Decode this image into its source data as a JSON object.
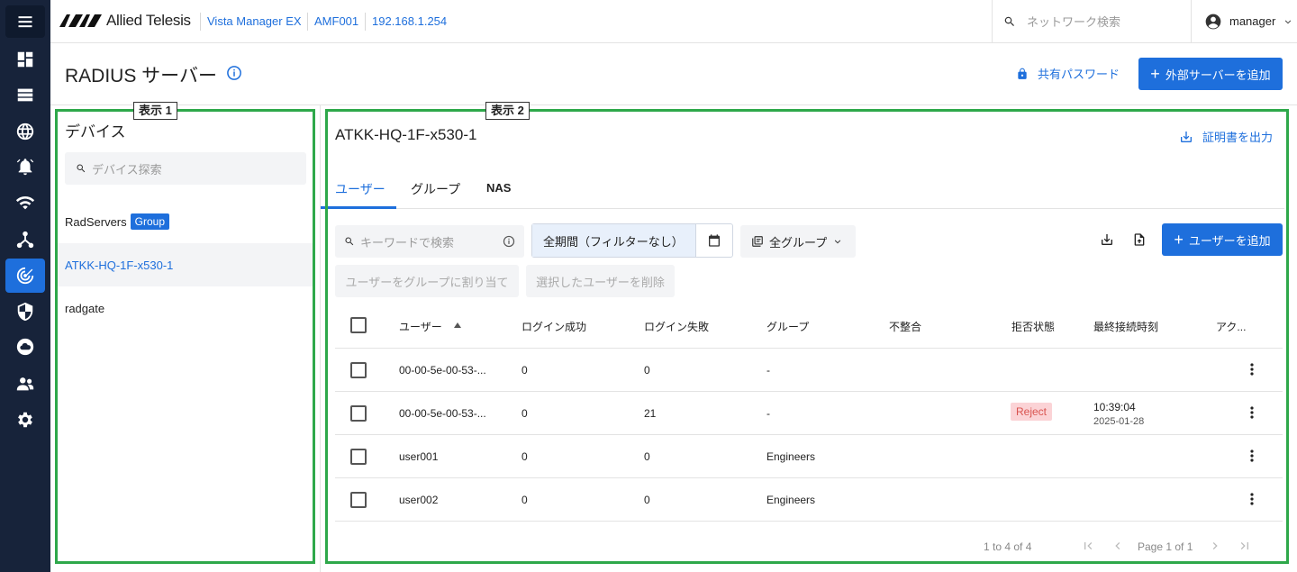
{
  "header": {
    "brand": "Allied Telesis",
    "breadcrumbs": [
      "Vista Manager EX",
      "AMF001",
      "192.168.1.254"
    ],
    "search_placeholder": "ネットワーク検索",
    "user": "manager"
  },
  "page": {
    "title": "RADIUS サーバー",
    "shared_password": "共有パスワード",
    "add_external_server": "外部サーバーを追加"
  },
  "annotations": {
    "view1": "表示 1",
    "view2": "表示 2"
  },
  "devices": {
    "title": "デバイス",
    "search_placeholder": "デバイス探索",
    "items": [
      {
        "name": "RadServers",
        "badge": "Group"
      },
      {
        "name": "ATKK-HQ-1F-x530-1",
        "selected": true
      },
      {
        "name": "radgate"
      }
    ]
  },
  "detail": {
    "title": "ATKK-HQ-1F-x530-1",
    "export_cert": "証明書を出力",
    "tabs": [
      "ユーザー",
      "グループ",
      "NAS"
    ],
    "active_tab": "ユーザー",
    "keyword_placeholder": "キーワードで検索",
    "period": "全期間（フィルターなし）",
    "group_filter": "全グループ",
    "add_user": "ユーザーを追加",
    "assign_group": "ユーザーをグループに割り当て",
    "delete_selected": "選択したユーザーを削除"
  },
  "table": {
    "columns": [
      "ユーザー",
      "ログイン成功",
      "ログイン失敗",
      "グループ",
      "不整合",
      "拒否状態",
      "最終接続時刻",
      "アク..."
    ],
    "rows": [
      {
        "user": "00-00-5e-00-53-...",
        "success": "0",
        "fail": "0",
        "group": "-",
        "mismatch": "",
        "reject": "",
        "time": "",
        "date": ""
      },
      {
        "user": "00-00-5e-00-53-...",
        "success": "0",
        "fail": "21",
        "group": "-",
        "mismatch": "",
        "reject": "Reject",
        "time": "10:39:04",
        "date": "2025-01-28"
      },
      {
        "user": "user001",
        "success": "0",
        "fail": "0",
        "group": "Engineers",
        "mismatch": "",
        "reject": "",
        "time": "",
        "date": ""
      },
      {
        "user": "user002",
        "success": "0",
        "fail": "0",
        "group": "Engineers",
        "mismatch": "",
        "reject": "",
        "time": "",
        "date": ""
      }
    ]
  },
  "pagination": {
    "range": "1 to 4 of 4",
    "page": "Page 1 of 1"
  },
  "colors": {
    "accent": "#1e6fdc",
    "nav_bg": "#17233a",
    "highlight": "#2ea84a",
    "reject_bg": "#fbd3d6"
  }
}
